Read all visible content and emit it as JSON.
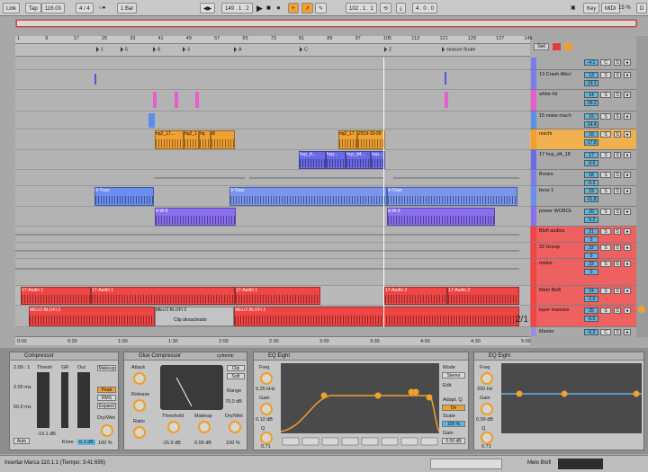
{
  "control_bar": {
    "link": "Link",
    "tap": "Tap",
    "tempo": "116.00",
    "meter": "4 / 4",
    "metro": "1 Bar",
    "position": "149 . 1 . 2",
    "loop_start": "102 . 1 . 1",
    "loop_len": "4 . 0 . 0",
    "key": "Key",
    "midi": "MIDI",
    "cpu": "15 %",
    "d": "D"
  },
  "ruler": {
    "bars": [
      "1",
      "9",
      "17",
      "25",
      "33",
      "41",
      "49",
      "57",
      "65",
      "73",
      "81",
      "89",
      "97",
      "105",
      "113",
      "121",
      "129",
      "137",
      "145"
    ],
    "times": [
      "0:00",
      "0:30",
      "1:00",
      "1:30",
      "2:00",
      "2:30",
      "3:00",
      "3:30",
      "4:00",
      "4:30",
      "5:00"
    ]
  },
  "markers": [
    "1",
    "5",
    "8",
    "3",
    "A",
    "C",
    "2",
    "season finale"
  ],
  "set_label": "Set",
  "tracks": [
    {
      "name": "",
      "vol": "-4.1",
      "pan": "C",
      "color": "#7b7bf0"
    },
    {
      "name": "13 Crash Alko!",
      "vol": "13",
      "pan": "S",
      "vol2": "-19.1",
      "color": "#7b7bf0"
    },
    {
      "name": "white hit",
      "vol": "14",
      "pan": "S",
      "vol2": "-18.2",
      "color": "#e75ed0"
    },
    {
      "name": "15 noise mach",
      "vol": "15",
      "pan": "S",
      "vol2": "-14.4",
      "color": "#5a8ee8"
    },
    {
      "name": "noichi",
      "vol": "16",
      "pan": "S",
      "vol2": "-17.8",
      "color": "#f0a030"
    },
    {
      "name": "17 hcp_d4_18",
      "vol": "17",
      "pan": "S",
      "vol2": "-9.6",
      "color": "#6a6ae8"
    },
    {
      "name": "Bones",
      "vol": "18",
      "pan": "S",
      "vol2": "-0.3",
      "color": "#7b7bf0"
    },
    {
      "name": "bess 1",
      "vol": "19",
      "pan": "S",
      "vol2": "-11.8",
      "color": "#6a8ef0"
    },
    {
      "name": "power WOBOL",
      "vol": "20",
      "pan": "S",
      "vol2": "-5.2",
      "color": "#8a6ef0"
    },
    {
      "name": "Blofi audios",
      "vol": "21",
      "pan": "S",
      "vol2": "0",
      "color": "#ef4545"
    },
    {
      "name": "22 Group",
      "vol": "22",
      "pan": "S",
      "vol2": "0",
      "color": "#ef4545"
    },
    {
      "name": "melos",
      "vol": "23",
      "pan": "S",
      "vol2": "0",
      "color": "#ef4545"
    },
    {
      "name": "Melo Blofi",
      "vol": "24",
      "pan": "S",
      "vol2": "-2.0",
      "color": "#ef4545"
    },
    {
      "name": "layer massive",
      "vol": "25",
      "pan": "S",
      "vol2": "-6.5",
      "color": "#ef4545"
    },
    {
      "name": "Master",
      "vol": "-6.2",
      "pan": "C",
      "vol2": "-10.4",
      "color": "#9b8ee0"
    }
  ],
  "page_indicator": "2/1",
  "clips": {
    "noichi": [
      "hq2_17...",
      "hq2_1",
      "hq",
      "i8",
      "hq2_17",
      "2019-10-09"
    ],
    "hcp": [
      "hcp_d...",
      "hcp...",
      "hcp_d4...",
      "hcp..."
    ],
    "bass_clip": "9-Trian",
    "wobol_clip": "8-W-9",
    "audio1": "17-Audio 1",
    "audio2": "17-Audio 2",
    "melo": "MELO BLOFI 2",
    "disabled": "Clip desactivado"
  },
  "devices": {
    "compressor": {
      "title": "Compressor",
      "ratio": "2.00 : 1",
      "attack": "2.00 ms",
      "release": "50.0 ms",
      "thresh": "Thresh",
      "gr": "GR",
      "out": "Out",
      "thresh_val": "-19.1 dB",
      "knee": "Knee",
      "knee_val": "6.1 dB",
      "makeup": "Makeup",
      "peak": "Peak",
      "rms": "RMS",
      "expand": "Expand",
      "drywet": "Dry/Wet",
      "drywet_val": "100 %",
      "auto": "Auto"
    },
    "glue": {
      "title": "Glue Compressor",
      "brand": "cytomic",
      "attack": "Attack",
      "release": "Release",
      "ratio": "Ratio",
      "threshold": "Threshold",
      "threshold_val": "-15.9 dB",
      "makeup": "Makeup",
      "makeup_val": "0.00 dB",
      "clip": "Clip",
      "soft": "Soft",
      "range": "Range",
      "range_val": "70.0 dB",
      "drywet": "Dry/Wet",
      "drywet_val": "100 %"
    },
    "eq1": {
      "title": "EQ Eight",
      "freq": "Freq",
      "freq_val": "6.25 kHz",
      "gain": "Gain",
      "gain_val": "0.12 dB",
      "q": "Q",
      "q_val": "0.71",
      "mode": "Mode",
      "mode_val": "Stereo",
      "edit": "Edit",
      "adapt": "Adapt. Q",
      "on": "On",
      "scale": "Scale",
      "scale_val": "100 %",
      "gain2": "Gain",
      "gain2_val": "0.00 dB",
      "axis": [
        "100",
        "1k",
        "10k"
      ],
      "db": [
        "12",
        "6",
        "0",
        "-6",
        "-12"
      ]
    },
    "eq2": {
      "title": "EQ Eight",
      "freq": "Freq",
      "freq_val": "200 Hz",
      "gain": "Gain",
      "gain_val": "0.00 dB",
      "q": "Q",
      "q_val": "0.71",
      "axis": [
        "100",
        "1k"
      ],
      "db": [
        "12",
        "6",
        "0",
        "-6",
        "-12"
      ]
    }
  },
  "status": {
    "text": "Insertar Marca 110.1.1 (Tiempo: 3:41:695)",
    "track": "Melo Blofi"
  }
}
